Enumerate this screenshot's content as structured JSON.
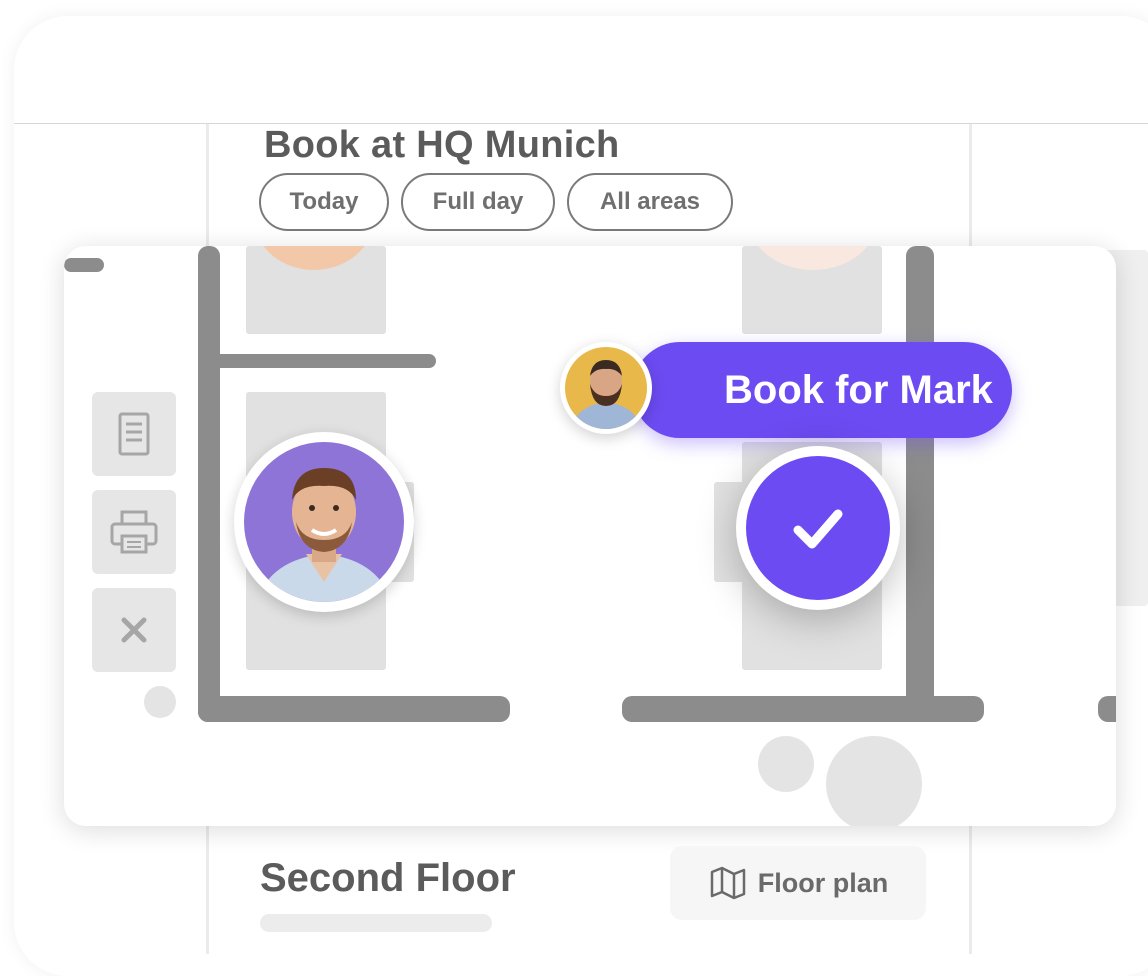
{
  "header": {
    "title": "Book at HQ Munich",
    "filters": [
      "Today",
      "Full day",
      "All areas"
    ]
  },
  "toolbar": {
    "icons": [
      "document-icon",
      "printer-icon",
      "close-icon"
    ]
  },
  "booking": {
    "label": "Book for Mark",
    "person": "Mark",
    "accent_color": "#6c4bf2"
  },
  "floor": {
    "name": "Second Floor",
    "plan_button": "Floor plan"
  }
}
